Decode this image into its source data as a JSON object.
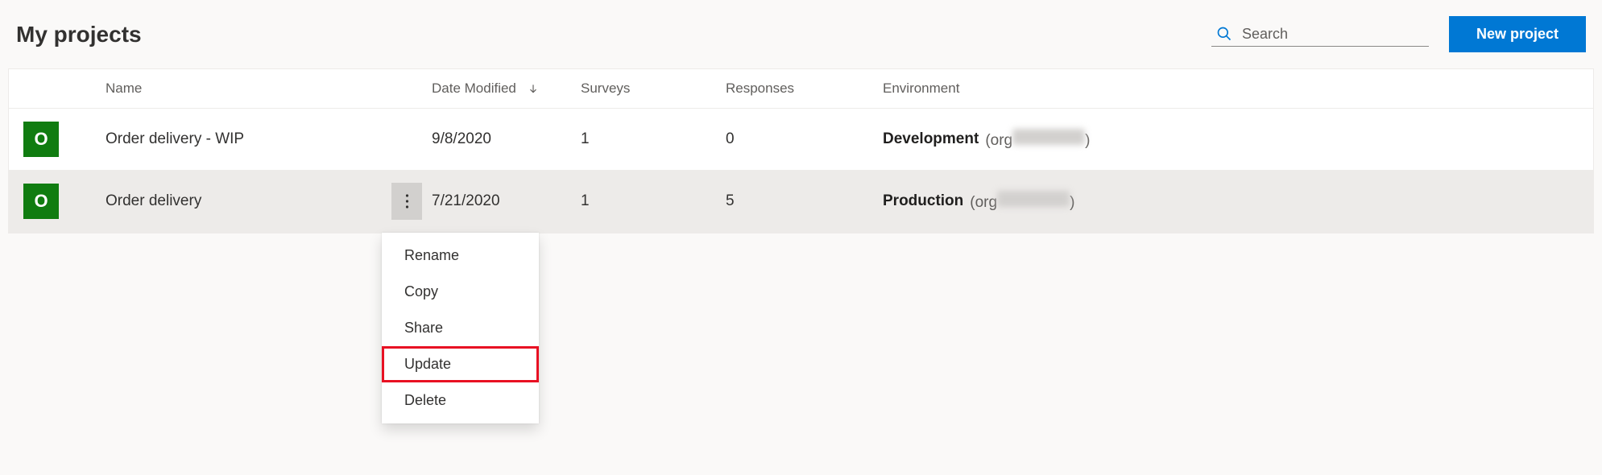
{
  "header": {
    "title": "My projects",
    "search_placeholder": "Search",
    "new_project_label": "New project"
  },
  "columns": {
    "name": "Name",
    "date": "Date Modified",
    "surveys": "Surveys",
    "responses": "Responses",
    "environment": "Environment"
  },
  "rows": [
    {
      "avatar_letter": "O",
      "name": "Order delivery - WIP",
      "date": "9/8/2020",
      "surveys": "1",
      "responses": "0",
      "env_label": "Development",
      "org_prefix": "(org",
      "org_suffix": ")",
      "active": false
    },
    {
      "avatar_letter": "O",
      "name": "Order delivery",
      "date": "7/21/2020",
      "surveys": "1",
      "responses": "5",
      "env_label": "Production",
      "org_prefix": " (org",
      "org_suffix": ")",
      "active": true
    }
  ],
  "menu": {
    "rename": "Rename",
    "copy": "Copy",
    "share": "Share",
    "update": "Update",
    "delete": "Delete"
  }
}
